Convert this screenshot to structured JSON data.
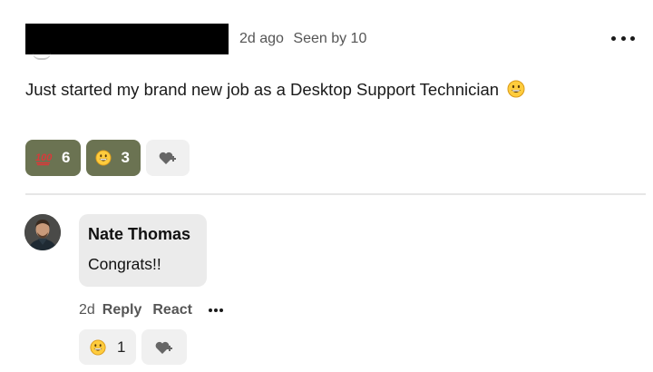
{
  "post": {
    "time_ago": "2d ago",
    "seen_by": "Seen by 10",
    "body": "Just started my brand new job as a Desktop Support Technician",
    "body_emoji": "grinning-face-icon",
    "reactions": [
      {
        "icon": "hundred-points-icon",
        "count": "6"
      },
      {
        "icon": "grinning-face-icon",
        "count": "3"
      }
    ],
    "add_reaction_icon": "heart-plus-icon",
    "more_icon": "more-horizontal-icon"
  },
  "comment": {
    "author": "Nate Thomas",
    "text": "Congrats!!",
    "time": "2d",
    "reply_label": "Reply",
    "react_label": "React",
    "reactions": [
      {
        "icon": "grinning-face-icon",
        "count": "1"
      }
    ]
  },
  "colors": {
    "reaction_active_bg": "#6b7352",
    "pill_inactive_bg": "#f0f0f0",
    "bubble_bg": "#ebebeb",
    "divider": "#e6e6e6"
  }
}
